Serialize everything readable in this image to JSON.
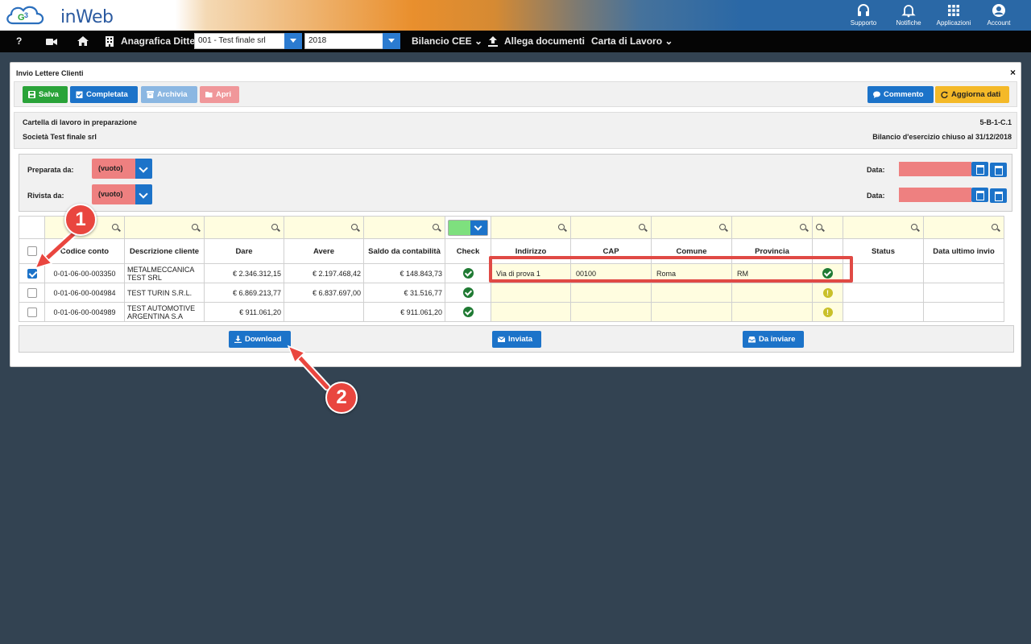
{
  "app": {
    "logo_text": "inWeb"
  },
  "top_icons": [
    {
      "label": "Supporto",
      "icon": "headset-icon"
    },
    {
      "label": "Notifiche",
      "icon": "bell-icon"
    },
    {
      "label": "Applicazioni",
      "icon": "apps-grid-icon"
    },
    {
      "label": "Account",
      "icon": "account-icon"
    }
  ],
  "navbar": {
    "help": "?",
    "anagrafica_label": "Anagrafica Ditte",
    "company_select": "001 - Test finale srl",
    "year_select": "2018",
    "bilancio_label": "Bilancio CEE",
    "allega_label": "Allega documenti",
    "carta_label": "Carta di Lavoro"
  },
  "modal": {
    "title": "Invio Lettere Clienti",
    "close": "×",
    "toolbar": {
      "salva": "Salva",
      "completata": "Completata",
      "archivia": "Archivia",
      "apri": "Apri",
      "commento": "Commento",
      "aggiorna": "Aggiorna dati"
    },
    "info": {
      "status": "Cartella di lavoro in preparazione",
      "company": "Società Test finale srl",
      "code": "5-B-1-C.1",
      "bilancio": "Bilancio d'esercizio chiuso al 31/12/2018"
    },
    "prep": {
      "preparata_label": "Preparata da:",
      "preparata_value": "(vuoto)",
      "rivista_label": "Rivista da:",
      "rivista_value": "(vuoto)",
      "data_label": "Data:"
    },
    "table": {
      "headers": [
        "Codice conto",
        "Descrizione cliente",
        "Dare",
        "Avere",
        "Saldo da contabilità",
        "Check",
        "Indirizzo",
        "CAP",
        "Comune",
        "Provincia",
        "",
        "Status",
        "Data ultimo invio"
      ],
      "rows": [
        {
          "checked": true,
          "codice": "0-01-06-00-003350",
          "descr": "METALMECCANICA TEST SRL",
          "dare": "€ 2.346.312,15",
          "avere": "€ 2.197.468,42",
          "saldo": "€ 148.843,73",
          "check": "ok",
          "indirizzo": "Via di prova 1",
          "cap": "00100",
          "comune": "Roma",
          "provincia": "RM",
          "addr_status": "ok",
          "status": "",
          "data_invio": ""
        },
        {
          "checked": false,
          "codice": "0-01-06-00-004984",
          "descr": "TEST TURIN S.R.L.",
          "dare": "€ 6.869.213,77",
          "avere": "€ 6.837.697,00",
          "saldo": "€ 31.516,77",
          "check": "ok",
          "indirizzo": "",
          "cap": "",
          "comune": "",
          "provincia": "",
          "addr_status": "warn",
          "status": "",
          "data_invio": ""
        },
        {
          "checked": false,
          "codice": "0-01-06-00-004989",
          "descr": "TEST AUTOMOTIVE ARGENTINA S.A",
          "dare": "€ 911.061,20",
          "avere": "",
          "saldo": "€ 911.061,20",
          "check": "ok",
          "indirizzo": "",
          "cap": "",
          "comune": "",
          "provincia": "",
          "addr_status": "warn",
          "status": "",
          "data_invio": ""
        }
      ]
    },
    "footer": {
      "download": "Download",
      "inviata": "Inviata",
      "da_inviare": "Da inviare"
    }
  },
  "annotations": {
    "badge1": "1",
    "badge2": "2",
    "color": "#e9463f"
  }
}
